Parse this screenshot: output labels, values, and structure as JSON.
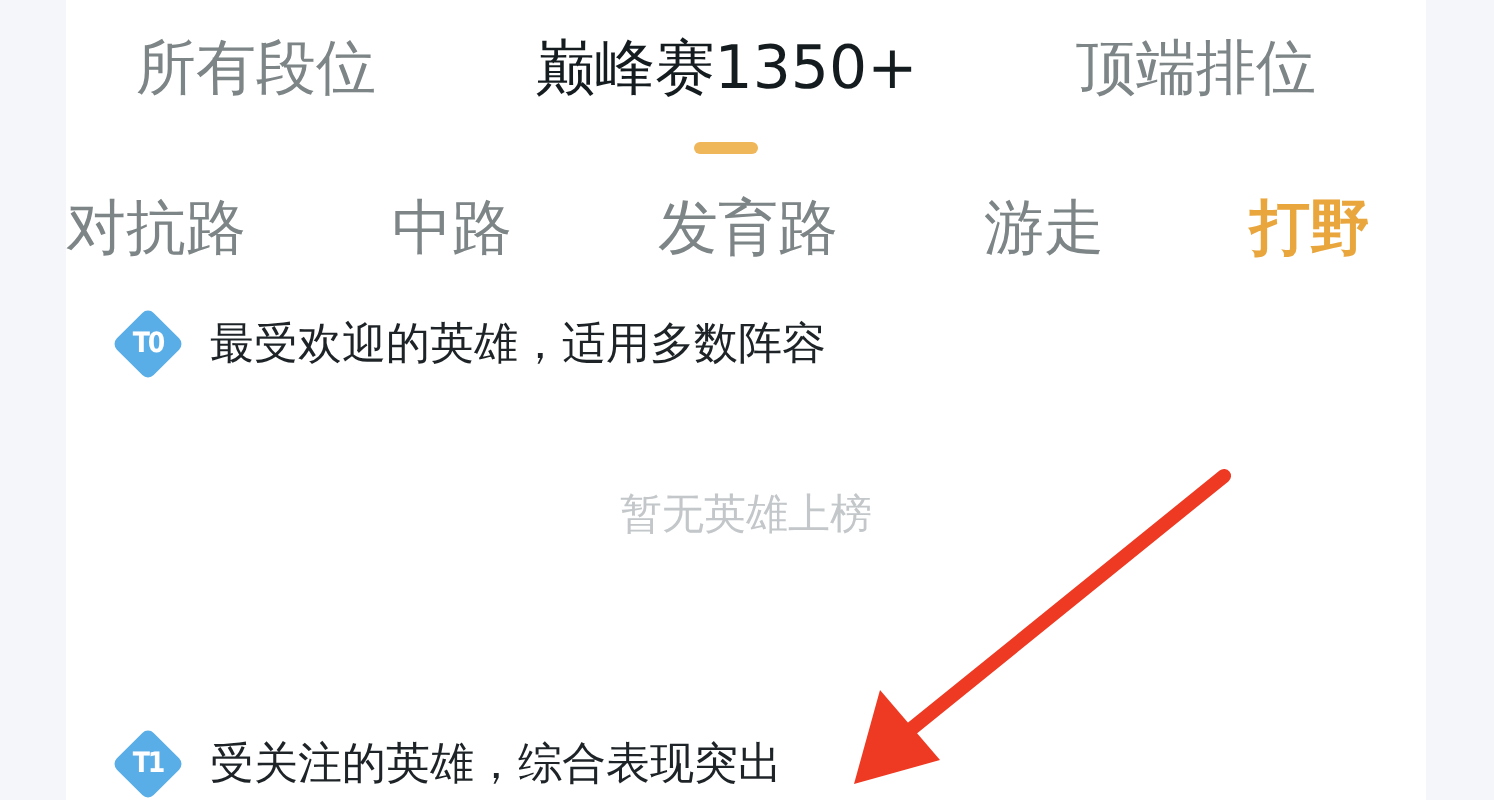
{
  "rank_tabs": [
    {
      "label": "所有段位",
      "selected": false
    },
    {
      "label": "巅峰赛1350+",
      "selected": true
    },
    {
      "label": "顶端排位",
      "selected": false
    }
  ],
  "lane_tabs": [
    {
      "label": "对抗路",
      "selected": false
    },
    {
      "label": "中路",
      "selected": false
    },
    {
      "label": "发育路",
      "selected": false
    },
    {
      "label": "游走",
      "selected": false
    },
    {
      "label": "打野",
      "selected": true
    }
  ],
  "tiers": [
    {
      "badge": "T0",
      "description": "最受欢迎的英雄，适用多数阵容",
      "empty_text": "暂无英雄上榜"
    },
    {
      "badge": "T1",
      "description": "受关注的英雄，综合表现突出"
    }
  ]
}
